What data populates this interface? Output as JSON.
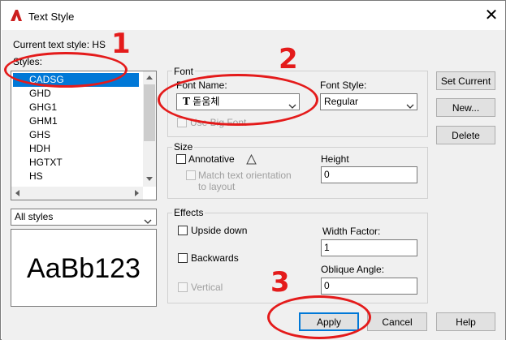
{
  "dialog": {
    "title": "Text Style",
    "current_style_label": "Current text style:",
    "current_style_value": "HS"
  },
  "styles": {
    "label": "Styles:",
    "items": [
      "CADSG",
      "GHD",
      "GHG1",
      "GHM1",
      "GHS",
      "HDH",
      "HGTXT",
      "HS"
    ],
    "selected": "CADSG",
    "filter": "All styles",
    "preview_text": "AaBb123"
  },
  "font": {
    "group_label": "Font",
    "name_label": "Font Name:",
    "name_value": "돋움체",
    "style_label": "Font Style:",
    "style_value": "Regular",
    "use_big_font": "Use Big Font"
  },
  "size": {
    "group_label": "Size",
    "annotative": "Annotative",
    "match_orientation": "Match text orientation to layout",
    "height_label": "Height",
    "height_value": "0"
  },
  "effects": {
    "group_label": "Effects",
    "upside_down": "Upside down",
    "backwards": "Backwards",
    "vertical": "Vertical",
    "width_factor_label": "Width Factor:",
    "width_factor_value": "1",
    "oblique_label": "Oblique Angle:",
    "oblique_value": "0"
  },
  "buttons": {
    "set_current": "Set Current",
    "new": "New...",
    "delete": "Delete",
    "apply": "Apply",
    "cancel": "Cancel",
    "help": "Help"
  },
  "annotations": [
    "1",
    "2",
    "3"
  ],
  "colors": {
    "annotation": "#e41b1b",
    "selection": "#0078d7",
    "app_icon": "#cc1f1f"
  }
}
